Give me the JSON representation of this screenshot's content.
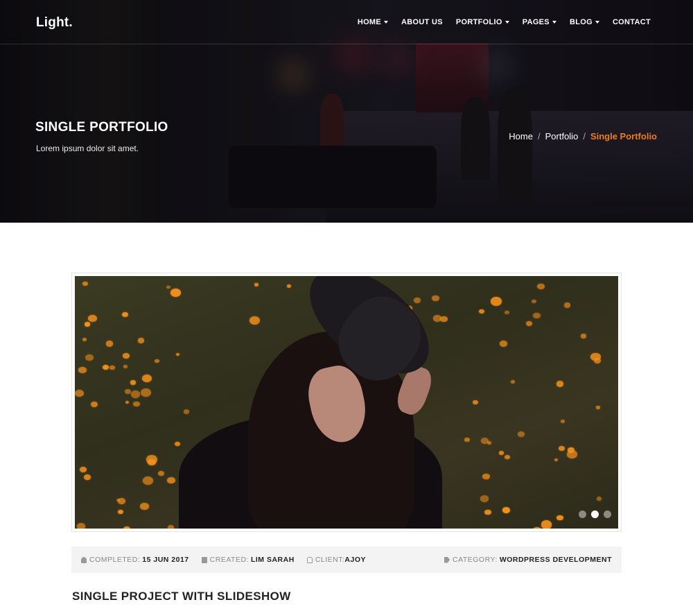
{
  "header": {
    "logo": "Light.",
    "nav": [
      {
        "label": "HOME",
        "dropdown": true
      },
      {
        "label": "ABOUT US",
        "dropdown": false
      },
      {
        "label": "PORTFOLIO",
        "dropdown": true
      },
      {
        "label": "PAGES",
        "dropdown": true
      },
      {
        "label": "BLOG",
        "dropdown": true
      },
      {
        "label": "CONTACT",
        "dropdown": false
      }
    ]
  },
  "hero": {
    "title": "SINGLE PORTFOLIO",
    "subtitle": "Lorem ipsum dolor sit amet.",
    "breadcrumb": [
      "Home",
      "Portfolio",
      "Single Portfolio"
    ]
  },
  "slideshow": {
    "active_slide": 2,
    "slide_count": 3
  },
  "meta": {
    "completed_label": "COMPLETED:",
    "completed_value": "15 JUN 2017",
    "created_label": "CREATED:",
    "created_value": "LIM SARAH",
    "client_label": "CLIENT:",
    "client_value": "AJOY",
    "category_label": "CATEGORY:",
    "category_value": "WORDPRESS DEVELOPMENT"
  },
  "project": {
    "title": "SINGLE PROJECT WITH SLIDESHOW"
  },
  "colors": {
    "accent": "#f07c1b",
    "meta_bg": "#f3f3f3"
  }
}
